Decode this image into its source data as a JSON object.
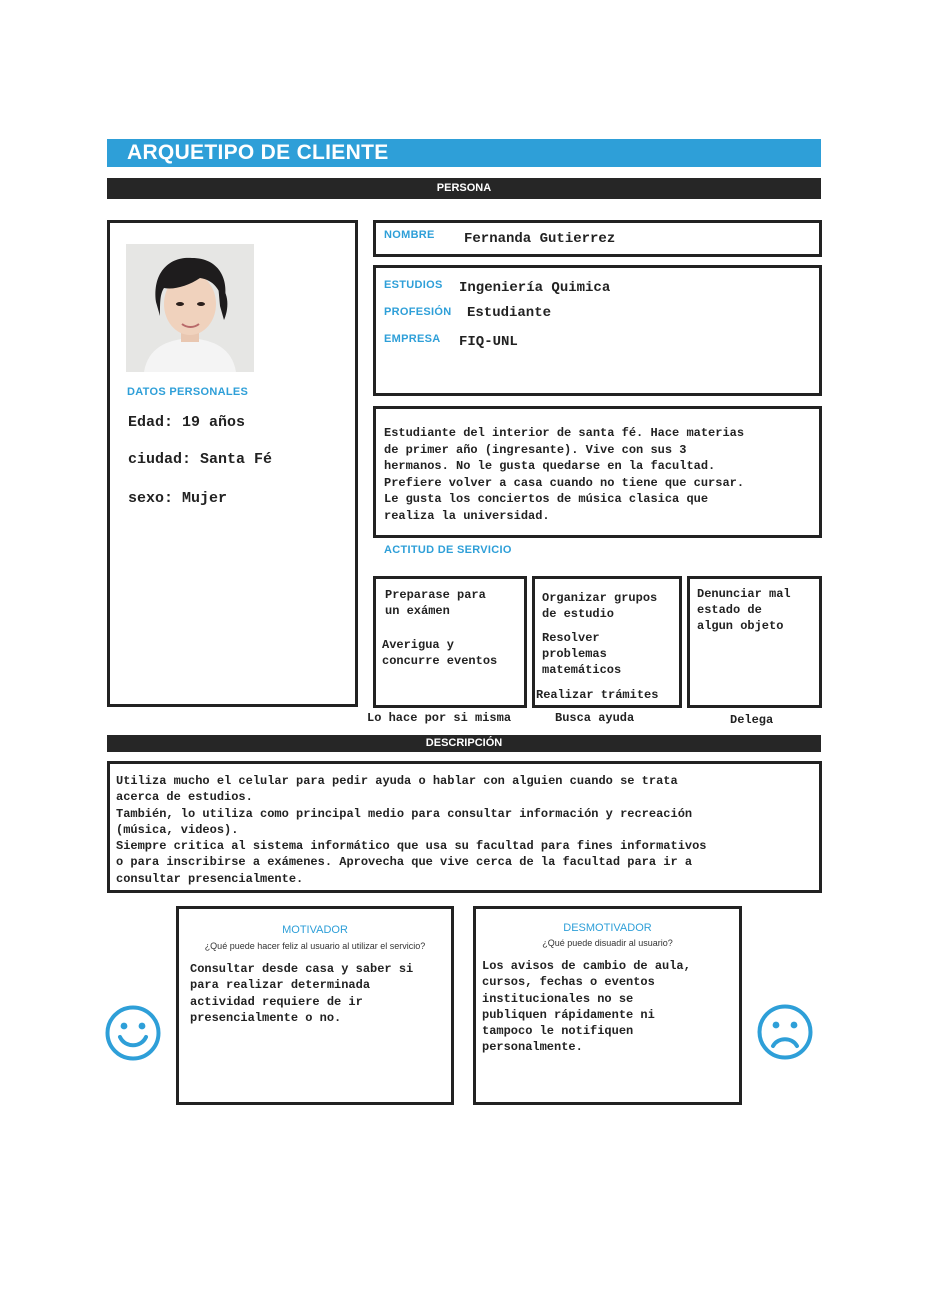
{
  "title": "ARQUETIPO DE CLIENTE",
  "section_persona": "PERSONA",
  "datos_personales": {
    "label": "DATOS PERSONALES",
    "edad": "Edad: 19 años",
    "ciudad": "ciudad: Santa Fé",
    "sexo": "sexo: Mujer"
  },
  "nombre": {
    "label": "NOMBRE",
    "value": "Fernanda Gutierrez"
  },
  "estudios": {
    "label": "ESTUDIOS",
    "value": "Ingeniería Quimica"
  },
  "profesion": {
    "label": "PROFESIÓN",
    "value": "Estudiante"
  },
  "empresa": {
    "label": "EMPRESA",
    "value": "FIQ-UNL"
  },
  "bio": [
    "Estudiante del interior de santa fé.  Hace materias",
    "de primer año (ingresante). Vive con sus 3",
    "hermanos. No le gusta quedarse en la facultad.",
    "Prefiere volver a casa cuando no tiene que cursar.",
    "Le gusta los conciertos de música clasica que",
    "realiza la universidad."
  ],
  "actitud": {
    "label": "ACTITUD DE SERVICIO",
    "columns": [
      {
        "items": [
          [
            "Preparase para",
            "un exámen"
          ],
          [
            "Averigua y",
            "concurre eventos"
          ]
        ],
        "caption": "Lo hace por si misma"
      },
      {
        "items": [
          [
            "Organizar grupos",
            "de estudio"
          ],
          [
            "Resolver",
            "problemas",
            "matemáticos"
          ],
          [
            "Realizar trámites"
          ]
        ],
        "caption": "Busca ayuda"
      },
      {
        "items": [
          [
            "Denunciar mal",
            "estado de",
            "algun objeto"
          ]
        ],
        "caption": "Delega"
      }
    ]
  },
  "section_descripcion": "DESCRIPCIÓN",
  "descripcion": [
    "Utiliza mucho el celular para pedir ayuda o hablar con alguien cuando se trata",
    "acerca de estudios.",
    "También, lo utiliza como principal medio para consultar información y recreación",
    "(música, videos).",
    "Siempre critica al sistema informático que usa su facultad para fines informativos",
    "o para inscribirse a exámenes. Aprovecha que vive cerca de la facultad para ir a",
    "consultar presencialmente."
  ],
  "motivador": {
    "title": "MOTIVADOR",
    "question": "¿Qué puede hacer feliz al usuario al utilizar el servicio?",
    "lines": [
      "Consultar desde casa y saber si",
      "para realizar determinada",
      "actividad requiere de ir",
      "presencialmente o no."
    ]
  },
  "desmotivador": {
    "title": "DESMOTIVADOR",
    "question": "¿Qué puede disuadir al usuario?",
    "lines": [
      "Los avisos de cambio de aula,",
      "cursos, fechas o eventos",
      "institucionales no se",
      "publiquen rápidamente ni",
      "tampoco le notifiquen",
      "personalmente."
    ]
  },
  "colors": {
    "accent": "#2e9fd8",
    "dark": "#262626"
  },
  "icons": {
    "happy": "smiley-happy-icon",
    "sad": "smiley-sad-icon"
  }
}
